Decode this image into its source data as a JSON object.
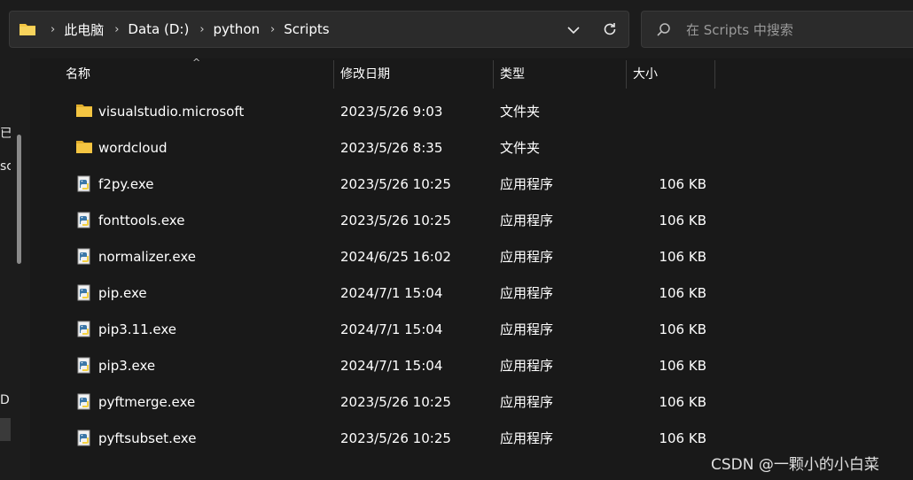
{
  "address_bar": {
    "segments": [
      "此电脑",
      "Data (D:)",
      "python",
      "Scripts"
    ]
  },
  "search": {
    "placeholder": "在 Scripts 中搜索"
  },
  "nav_fragments": [
    "已",
    "sc",
    "D ("
  ],
  "columns": {
    "name": "名称",
    "date": "修改日期",
    "type": "类型",
    "size": "大小"
  },
  "files": [
    {
      "name": "visualstudio.microsoft",
      "date": "2023/5/26 9:03",
      "type": "文件夹",
      "size": "",
      "icon": "folder-icon"
    },
    {
      "name": "wordcloud",
      "date": "2023/5/26 8:35",
      "type": "文件夹",
      "size": "",
      "icon": "folder-icon"
    },
    {
      "name": "f2py.exe",
      "date": "2023/5/26 10:25",
      "type": "应用程序",
      "size": "106 KB",
      "icon": "python-exe-icon"
    },
    {
      "name": "fonttools.exe",
      "date": "2023/5/26 10:25",
      "type": "应用程序",
      "size": "106 KB",
      "icon": "python-exe-icon"
    },
    {
      "name": "normalizer.exe",
      "date": "2024/6/25 16:02",
      "type": "应用程序",
      "size": "106 KB",
      "icon": "python-exe-icon"
    },
    {
      "name": "pip.exe",
      "date": "2024/7/1 15:04",
      "type": "应用程序",
      "size": "106 KB",
      "icon": "python-exe-icon"
    },
    {
      "name": "pip3.11.exe",
      "date": "2024/7/1 15:04",
      "type": "应用程序",
      "size": "106 KB",
      "icon": "python-exe-icon"
    },
    {
      "name": "pip3.exe",
      "date": "2024/7/1 15:04",
      "type": "应用程序",
      "size": "106 KB",
      "icon": "python-exe-icon"
    },
    {
      "name": "pyftmerge.exe",
      "date": "2023/5/26 10:25",
      "type": "应用程序",
      "size": "106 KB",
      "icon": "python-exe-icon"
    },
    {
      "name": "pyftsubset.exe",
      "date": "2023/5/26 10:25",
      "type": "应用程序",
      "size": "106 KB",
      "icon": "python-exe-icon"
    }
  ],
  "watermark": "CSDN @一颗小的小白菜",
  "colors": {
    "background": "#191919",
    "folder": "#f4c542",
    "python_blue": "#3b77a8",
    "python_yellow": "#f5d142"
  }
}
